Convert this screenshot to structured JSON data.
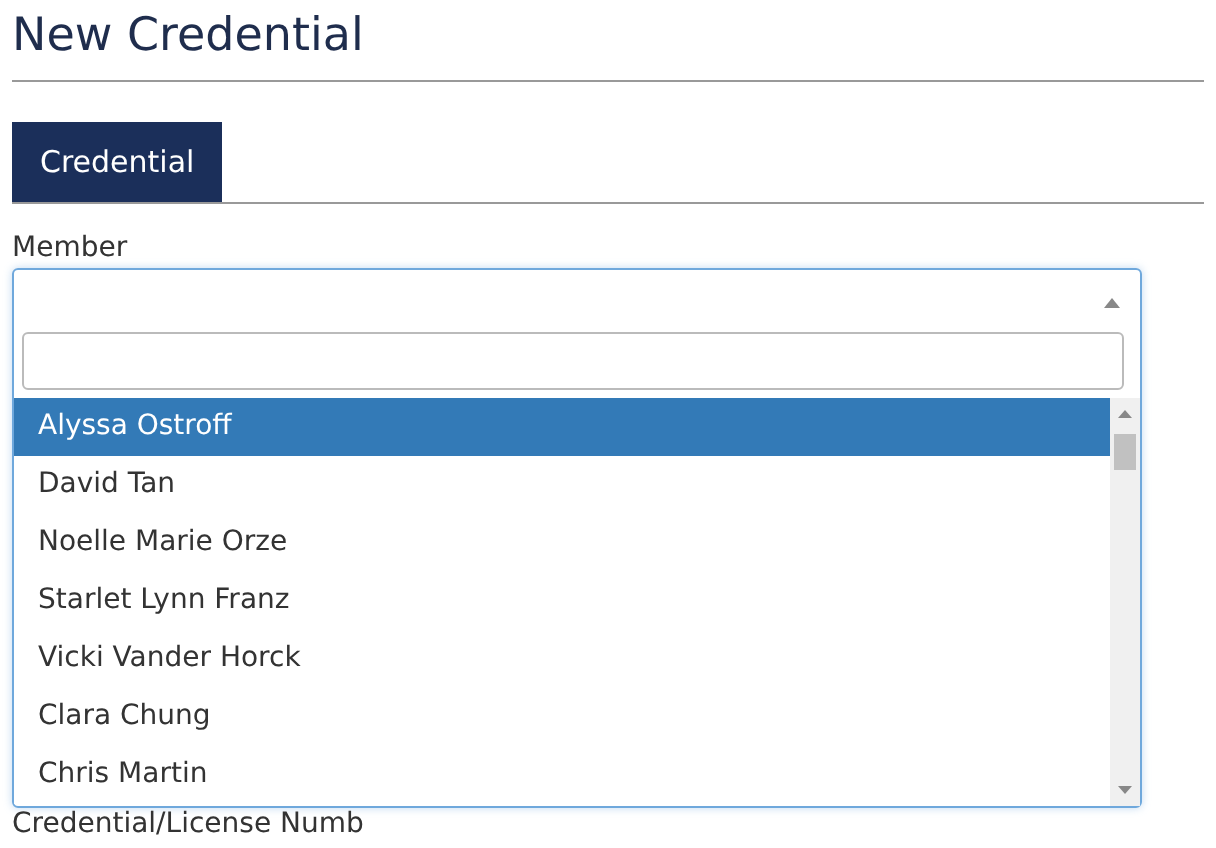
{
  "page": {
    "title": "New Credential"
  },
  "tabs": [
    {
      "label": "Credential",
      "selected": true
    }
  ],
  "member_field": {
    "label": "Member",
    "expanded": true,
    "options": [
      {
        "label": "Alyssa Ostroff",
        "selected": true
      },
      {
        "label": "David Tan",
        "selected": false
      },
      {
        "label": "Noelle Marie Orze",
        "selected": false
      },
      {
        "label": "Starlet Lynn Franz",
        "selected": false
      },
      {
        "label": "Vicki Vander Horck",
        "selected": false
      },
      {
        "label": "Clara Chung",
        "selected": false
      },
      {
        "label": "Chris Martin",
        "selected": false
      }
    ]
  },
  "next_field": {
    "label": "Credential/License Numb"
  }
}
